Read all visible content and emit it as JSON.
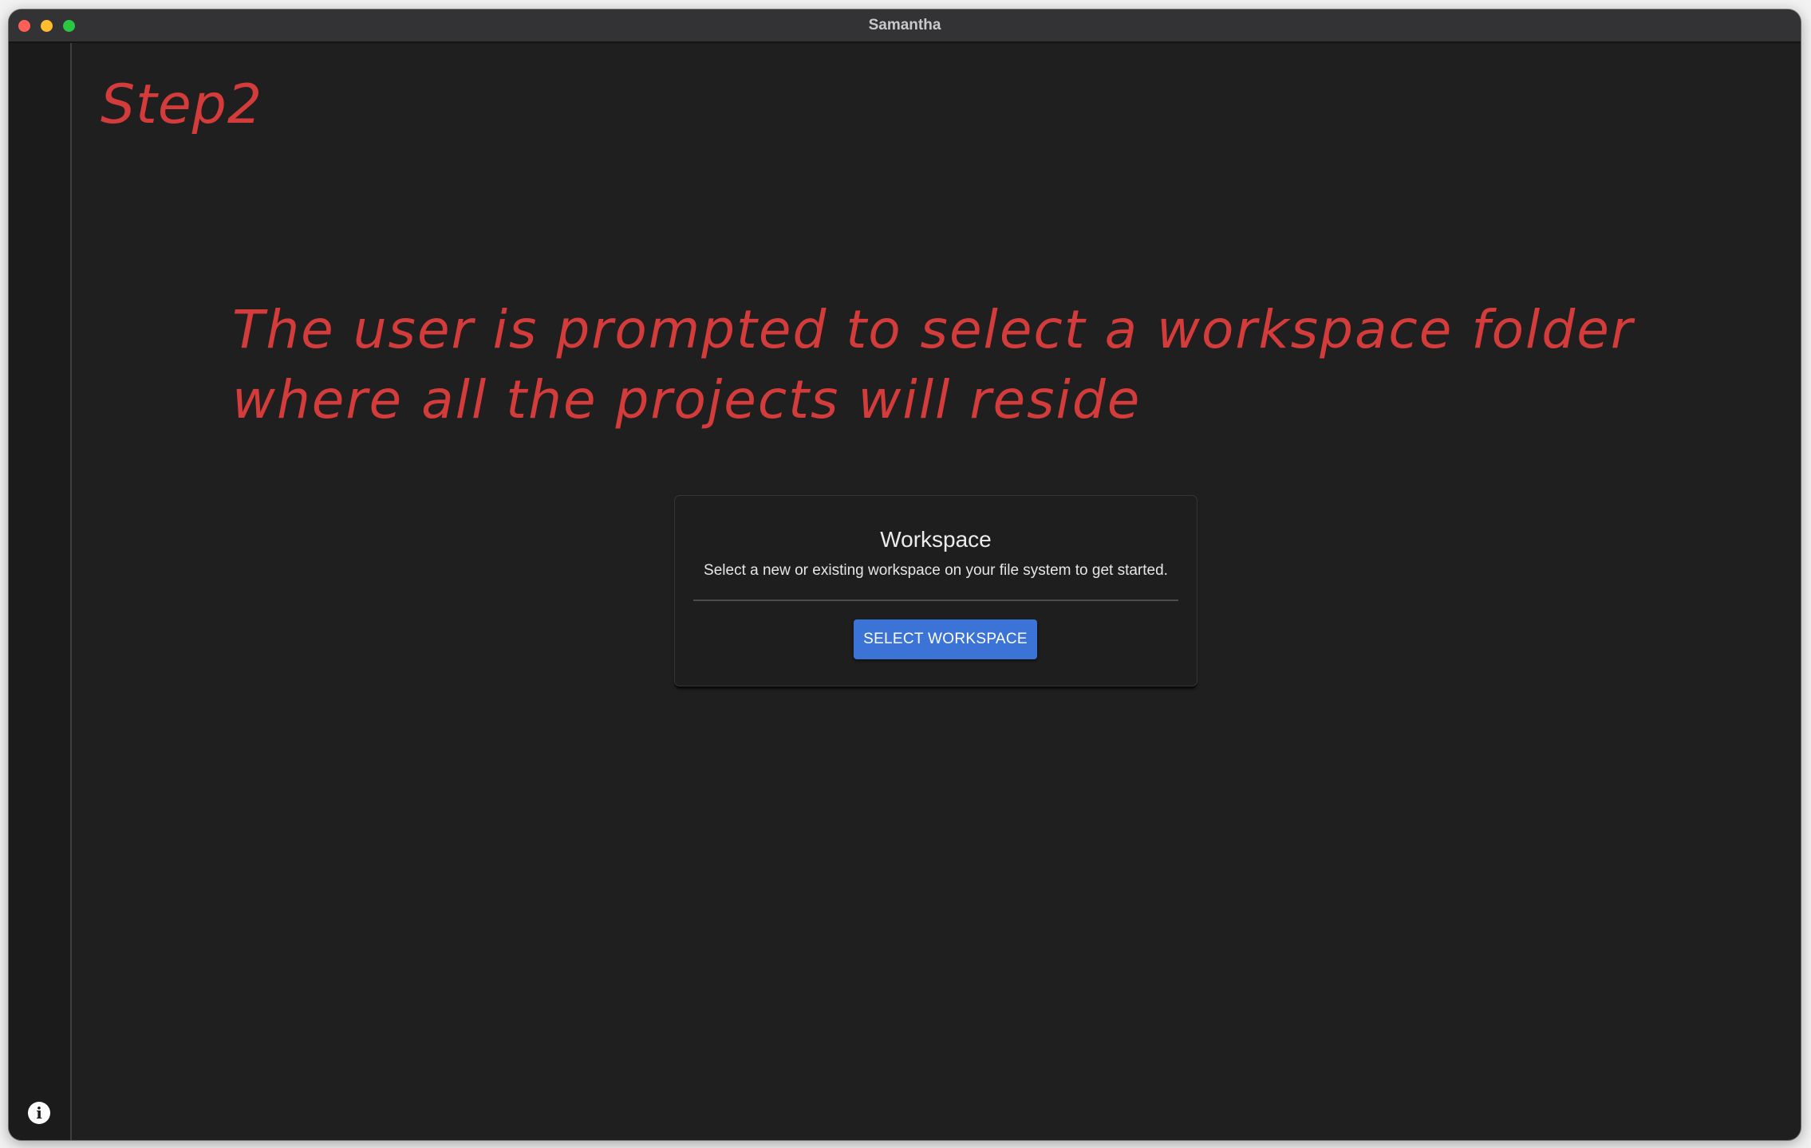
{
  "window": {
    "title": "Samantha"
  },
  "annotations": {
    "step": "Step2",
    "description_line1": "The user is prompted to select a workspace folder",
    "description_line2": "where all the projects will reside"
  },
  "card": {
    "title": "Workspace",
    "subtitle": "Select a new or existing workspace on your file system to get started.",
    "button_label": "SELECT WORKSPACE"
  },
  "sidebar": {
    "info_icon": "info-icon",
    "info_glyph": "i"
  },
  "colors": {
    "annotation": "#d43b3b",
    "button": "#3b74d6",
    "background": "#1f1f1f"
  }
}
